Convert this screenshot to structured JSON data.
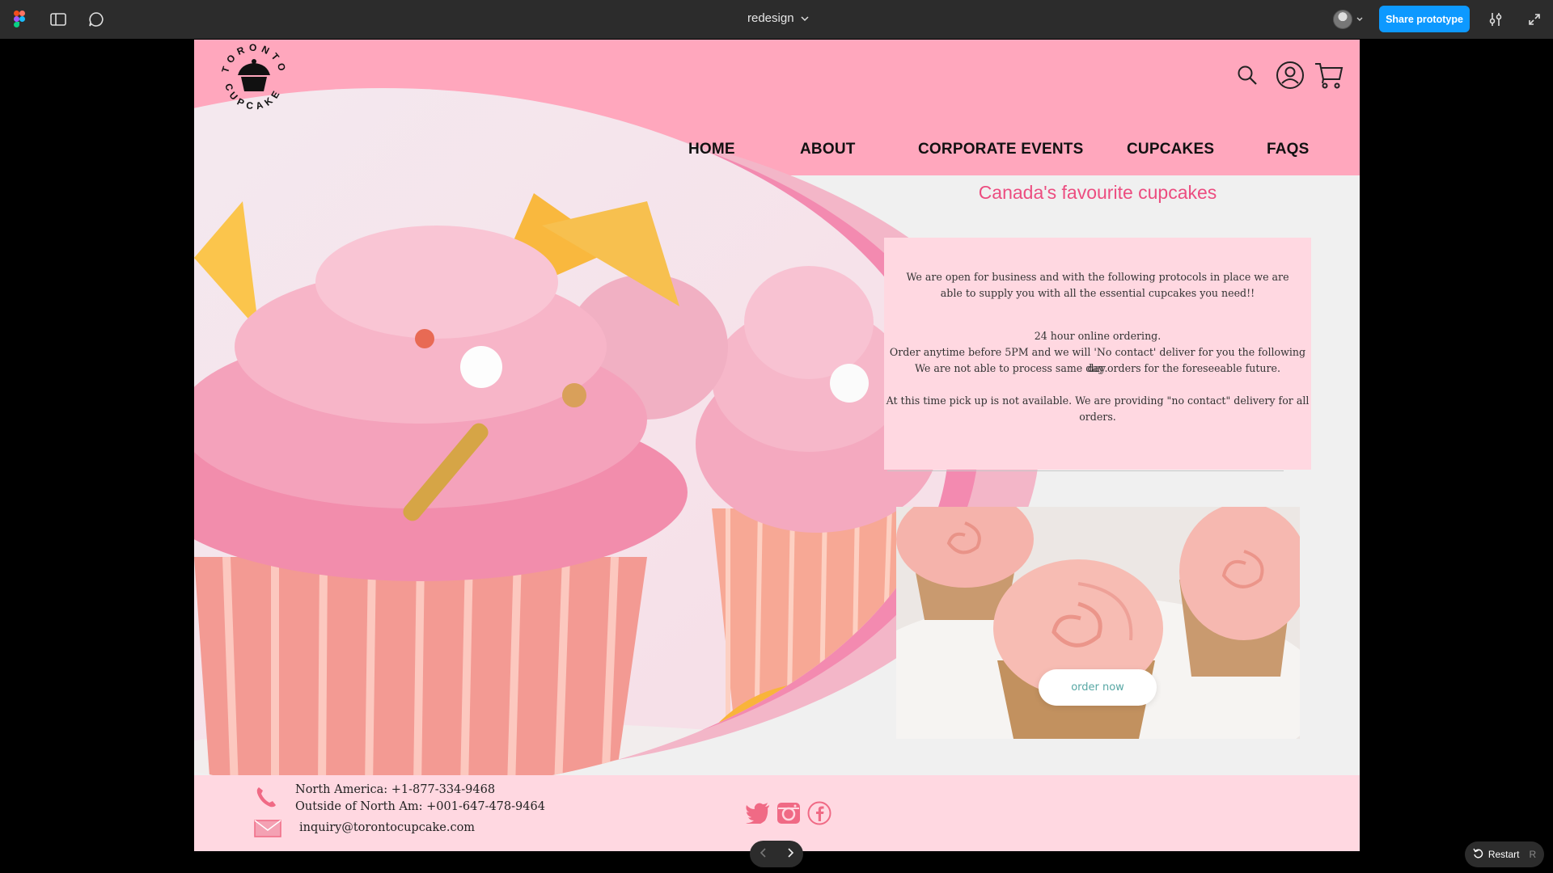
{
  "toolbar": {
    "file_title": "redesign",
    "share_label": "Share prototype"
  },
  "site": {
    "logo_text": "TORONTO CUPCAKE",
    "nav": [
      "HOME",
      "ABOUT",
      "CORPORATE EVENTS",
      "CUPCAKES",
      "FAQS"
    ],
    "tagline": "Canada's favourite cupcakes",
    "info": {
      "para1_line1": "We are open for business and with the following protocols in place we are",
      "para1_line2": "able to supply you with all the essential cupcakes you need!!",
      "line3": "24 hour online ordering.",
      "line4": "Order anytime before 5PM and we will 'No contact' deliver for you the following day.",
      "line5": "We are not able to process same day orders for the foreseeable future.",
      "line6": "At this time pick up is not available. We are providing \"no contact\" delivery for all orders."
    },
    "order_button": "order now",
    "footer": {
      "phone_na": "North America: +1-877-334-9468",
      "phone_other": "Outside of North Am: +001-647-478-9464",
      "email": "inquiry@torontocupcake.com"
    }
  },
  "bottom": {
    "restart_label": "Restart",
    "restart_key": "R"
  },
  "colors": {
    "header_pink": "#ffa7bd",
    "panel_pink": "#ffd8e1",
    "accent": "#ec4d80",
    "share_blue": "#0d99ff"
  },
  "icons": {
    "toolbar": [
      "figma-logo-icon",
      "sidebar-toggle-icon",
      "comment-icon",
      "chevron-down-icon",
      "settings-sliders-icon",
      "fullscreen-icon"
    ],
    "site": [
      "search-icon",
      "account-icon",
      "cart-icon",
      "phone-icon",
      "mail-icon",
      "twitter-icon",
      "instagram-icon",
      "facebook-icon"
    ]
  }
}
